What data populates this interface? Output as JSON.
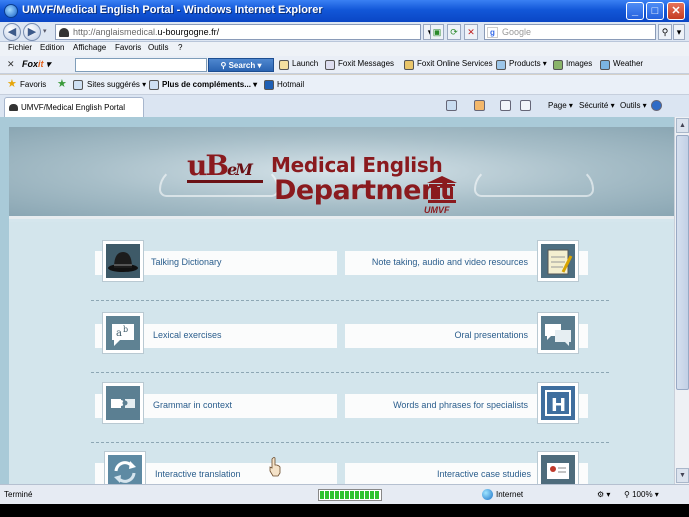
{
  "window": {
    "title": "UMVF/Medical English Portal - Windows Internet Explorer",
    "controls": {
      "minimize": "_",
      "maximize": "□",
      "close": "✕"
    }
  },
  "address": {
    "url_prefix": "http://anglaismedical.",
    "url_domain": "u-bourgogne.fr/",
    "search_placeholder": "Google",
    "search_engine_letter": "g"
  },
  "menu_bar": [
    "Fichier",
    "Edition",
    "Affichage",
    "Favoris",
    "Outils",
    "?"
  ],
  "foxit_toolbar": {
    "logo_prefix": "Fox",
    "logo_suffix": "it",
    "search_button": "Search",
    "items": [
      "Launch",
      "Foxit Messages",
      "Foxit Online Services",
      "Products",
      "Images",
      "Weather"
    ]
  },
  "favorites_bar": {
    "favorites": "Favoris",
    "items": [
      "Sites suggérés",
      "Plus de compléments...",
      "Hotmail"
    ]
  },
  "tabs": [
    {
      "label": "UMVF/Medical English Portal"
    }
  ],
  "command_bar": {
    "page": "Page",
    "security": "Sécurité",
    "tools": "Outils"
  },
  "banner": {
    "logo_letters": "uB",
    "logo_suffix": "eM",
    "title_line1": "Medical English",
    "title_line2": "Department",
    "umvf": "UMVF"
  },
  "menu_items": {
    "left": [
      {
        "label": "Talking Dictionary",
        "icon": "bowler-hat-icon"
      },
      {
        "label": "Lexical exercises",
        "icon": "speech-bubble-ab-icon"
      },
      {
        "label": "Grammar in context",
        "icon": "puzzle-icon"
      },
      {
        "label": "Interactive translation",
        "icon": "arrows-cycle-icon"
      }
    ],
    "right": [
      {
        "label": "Note taking, audio and video resources",
        "icon": "notepad-icon"
      },
      {
        "label": "Oral presentations",
        "icon": "chat-bubbles-icon"
      },
      {
        "label": "Words and phrases for specialists",
        "icon": "hospital-sign-icon"
      },
      {
        "label": "Interactive case studies",
        "icon": "presentation-icon"
      }
    ]
  },
  "status_bar": {
    "status": "Terminé",
    "zone": "Internet",
    "zoom": "100%",
    "progress": 1.0
  },
  "colors": {
    "title_bar": "#1257d8",
    "link": "#2a5d8c",
    "banner_red": "#8a1a1e",
    "content_bg": "#d3e5ec"
  }
}
